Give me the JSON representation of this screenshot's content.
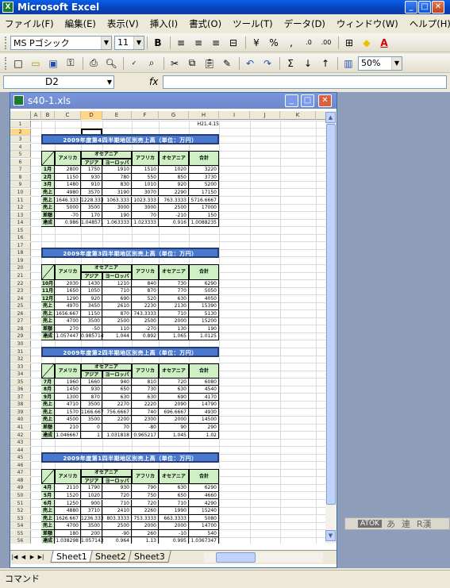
{
  "app": {
    "title": "Microsoft Excel"
  },
  "menu": [
    "ファイル(F)",
    "編集(E)",
    "表示(V)",
    "挿入(I)",
    "書式(O)",
    "ツール(T)",
    "データ(D)",
    "ウィンドウ(W)",
    "ヘルプ(H)"
  ],
  "format_toolbar": {
    "font": "MS Pゴシック",
    "size": "11"
  },
  "std_toolbar": {
    "zoom": "50%"
  },
  "formula": {
    "name_box": "D2",
    "fx": "fx"
  },
  "workbook": {
    "title": "s40-1.xls"
  },
  "columns": [
    "A",
    "B",
    "C",
    "D",
    "E",
    "F",
    "G",
    "H",
    "I",
    "J",
    "K"
  ],
  "rows": [
    "1",
    "2",
    "3",
    "4",
    "5",
    "6",
    "7",
    "8",
    "9",
    "10",
    "11",
    "12",
    "13",
    "14",
    "15",
    "16",
    "17",
    "18",
    "19",
    "20",
    "21",
    "22",
    "23",
    "24",
    "25",
    "26",
    "27",
    "28",
    "29",
    "30",
    "31",
    "32",
    "33",
    "34",
    "35",
    "36",
    "37",
    "38",
    "39",
    "40",
    "41",
    "42",
    "43",
    "44",
    "45",
    "46",
    "47",
    "48",
    "49",
    "50",
    "51",
    "52",
    "53",
    "54",
    "55",
    "56"
  ],
  "date_cell": "H21.4.15",
  "header": {
    "america": "アメリカ",
    "oceania": "オセアニア",
    "asia": "アジア",
    "europe": "ヨーロッパ",
    "africa": "アフリカ",
    "oceania2": "オセアニア",
    "total": "合計"
  },
  "sections": [
    {
      "title": "2009年度第4四半期地区別売上高（単位：万円）",
      "rows": [
        [
          "1月",
          "2800",
          "1750",
          "1910",
          "1510",
          "1020",
          "3220"
        ],
        [
          "2月",
          "1150",
          "930",
          "780",
          "550",
          "850",
          "3730"
        ],
        [
          "3月",
          "1480",
          "910",
          "830",
          "1010",
          "920",
          "5200"
        ],
        [
          "売上実績",
          "4980",
          "3570",
          "3190",
          "3070",
          "2290",
          "17150"
        ],
        [
          "売上平均",
          "1646.333",
          "1228.333",
          "1063.333",
          "1023.333",
          "763.3333",
          "5716.6667"
        ],
        [
          "売上目標",
          "5000",
          "3500",
          "3000",
          "3000",
          "2500",
          "17000"
        ],
        [
          "差額",
          "-70",
          "170",
          "190",
          "70",
          "-210",
          "150"
        ],
        [
          "達成率",
          "0.986",
          "1.048571",
          "1.063333",
          "1.023333",
          "0.916",
          "1.0088235"
        ]
      ]
    },
    {
      "title": "2009年度第3四半期地区別売上高（単位：万円）",
      "rows": [
        [
          "10月",
          "2030",
          "1430",
          "1210",
          "840",
          "730",
          "6290"
        ],
        [
          "11月",
          "1650",
          "1050",
          "710",
          "870",
          "770",
          "5050"
        ],
        [
          "12月",
          "1290",
          "920",
          "690",
          "520",
          "630",
          "4050"
        ],
        [
          "売上実績",
          "4970",
          "3450",
          "2610",
          "2230",
          "2130",
          "15390"
        ],
        [
          "売上平均",
          "1656.667",
          "1150",
          "870",
          "743.3333",
          "710",
          "5130"
        ],
        [
          "売上目標",
          "4700",
          "3500",
          "2500",
          "2500",
          "2000",
          "15200"
        ],
        [
          "差額",
          "270",
          "-50",
          "110",
          "-270",
          "130",
          "190"
        ],
        [
          "達成率",
          "1.057447",
          "0.985714",
          "1.044",
          "0.892",
          "1.065",
          "1.0125"
        ]
      ]
    },
    {
      "title": "2009年度第2四半期地区別売上高（単位：万円）",
      "rows": [
        [
          "7月",
          "1960",
          "1660",
          "940",
          "810",
          "720",
          "6080"
        ],
        [
          "8月",
          "1450",
          "930",
          "650",
          "730",
          "630",
          "4540"
        ],
        [
          "9月",
          "1300",
          "870",
          "630",
          "630",
          "690",
          "4170"
        ],
        [
          "売上実績",
          "4710",
          "3500",
          "2270",
          "2220",
          "2090",
          "14790"
        ],
        [
          "売上平均",
          "1570",
          "1166.667",
          "756.6667",
          "740",
          "696.6667",
          "4930"
        ],
        [
          "売上目標",
          "4500",
          "3500",
          "2200",
          "2300",
          "2000",
          "14500"
        ],
        [
          "差額",
          "210",
          "0",
          "70",
          "-80",
          "90",
          "290"
        ],
        [
          "達成率",
          "1.046667",
          "1",
          "1.031818",
          "0.965217",
          "1.045",
          "1.02"
        ]
      ]
    },
    {
      "title": "2009年度第1四半期地区別売上高（単位：万円）",
      "rows": [
        [
          "4月",
          "2110",
          "1790",
          "930",
          "790",
          "630",
          "6290"
        ],
        [
          "5月",
          "1520",
          "1020",
          "720",
          "750",
          "650",
          "4660"
        ],
        [
          "6月",
          "1250",
          "900",
          "710",
          "720",
          "710",
          "4290"
        ],
        [
          "売上実績",
          "4880",
          "3710",
          "2410",
          "2260",
          "1990",
          "15240"
        ],
        [
          "売上平均",
          "1626.667",
          "1236.333",
          "803.3333",
          "753.3333",
          "663.3333",
          "5080"
        ],
        [
          "売上目標",
          "4700",
          "3500",
          "2500",
          "2000",
          "2000",
          "14700"
        ],
        [
          "差額",
          "180",
          "200",
          "-90",
          "260",
          "-10",
          "540"
        ],
        [
          "達成率",
          "1.038298",
          "1.057143",
          "0.964",
          "1.13",
          "0.995",
          "1.0367347"
        ]
      ]
    }
  ],
  "sheet_tabs": [
    "Sheet1",
    "Sheet2",
    "Sheet3"
  ],
  "ime": {
    "label": "ATOK",
    "items": [
      "あ",
      "連",
      "R漢"
    ]
  },
  "status": "コマンド"
}
